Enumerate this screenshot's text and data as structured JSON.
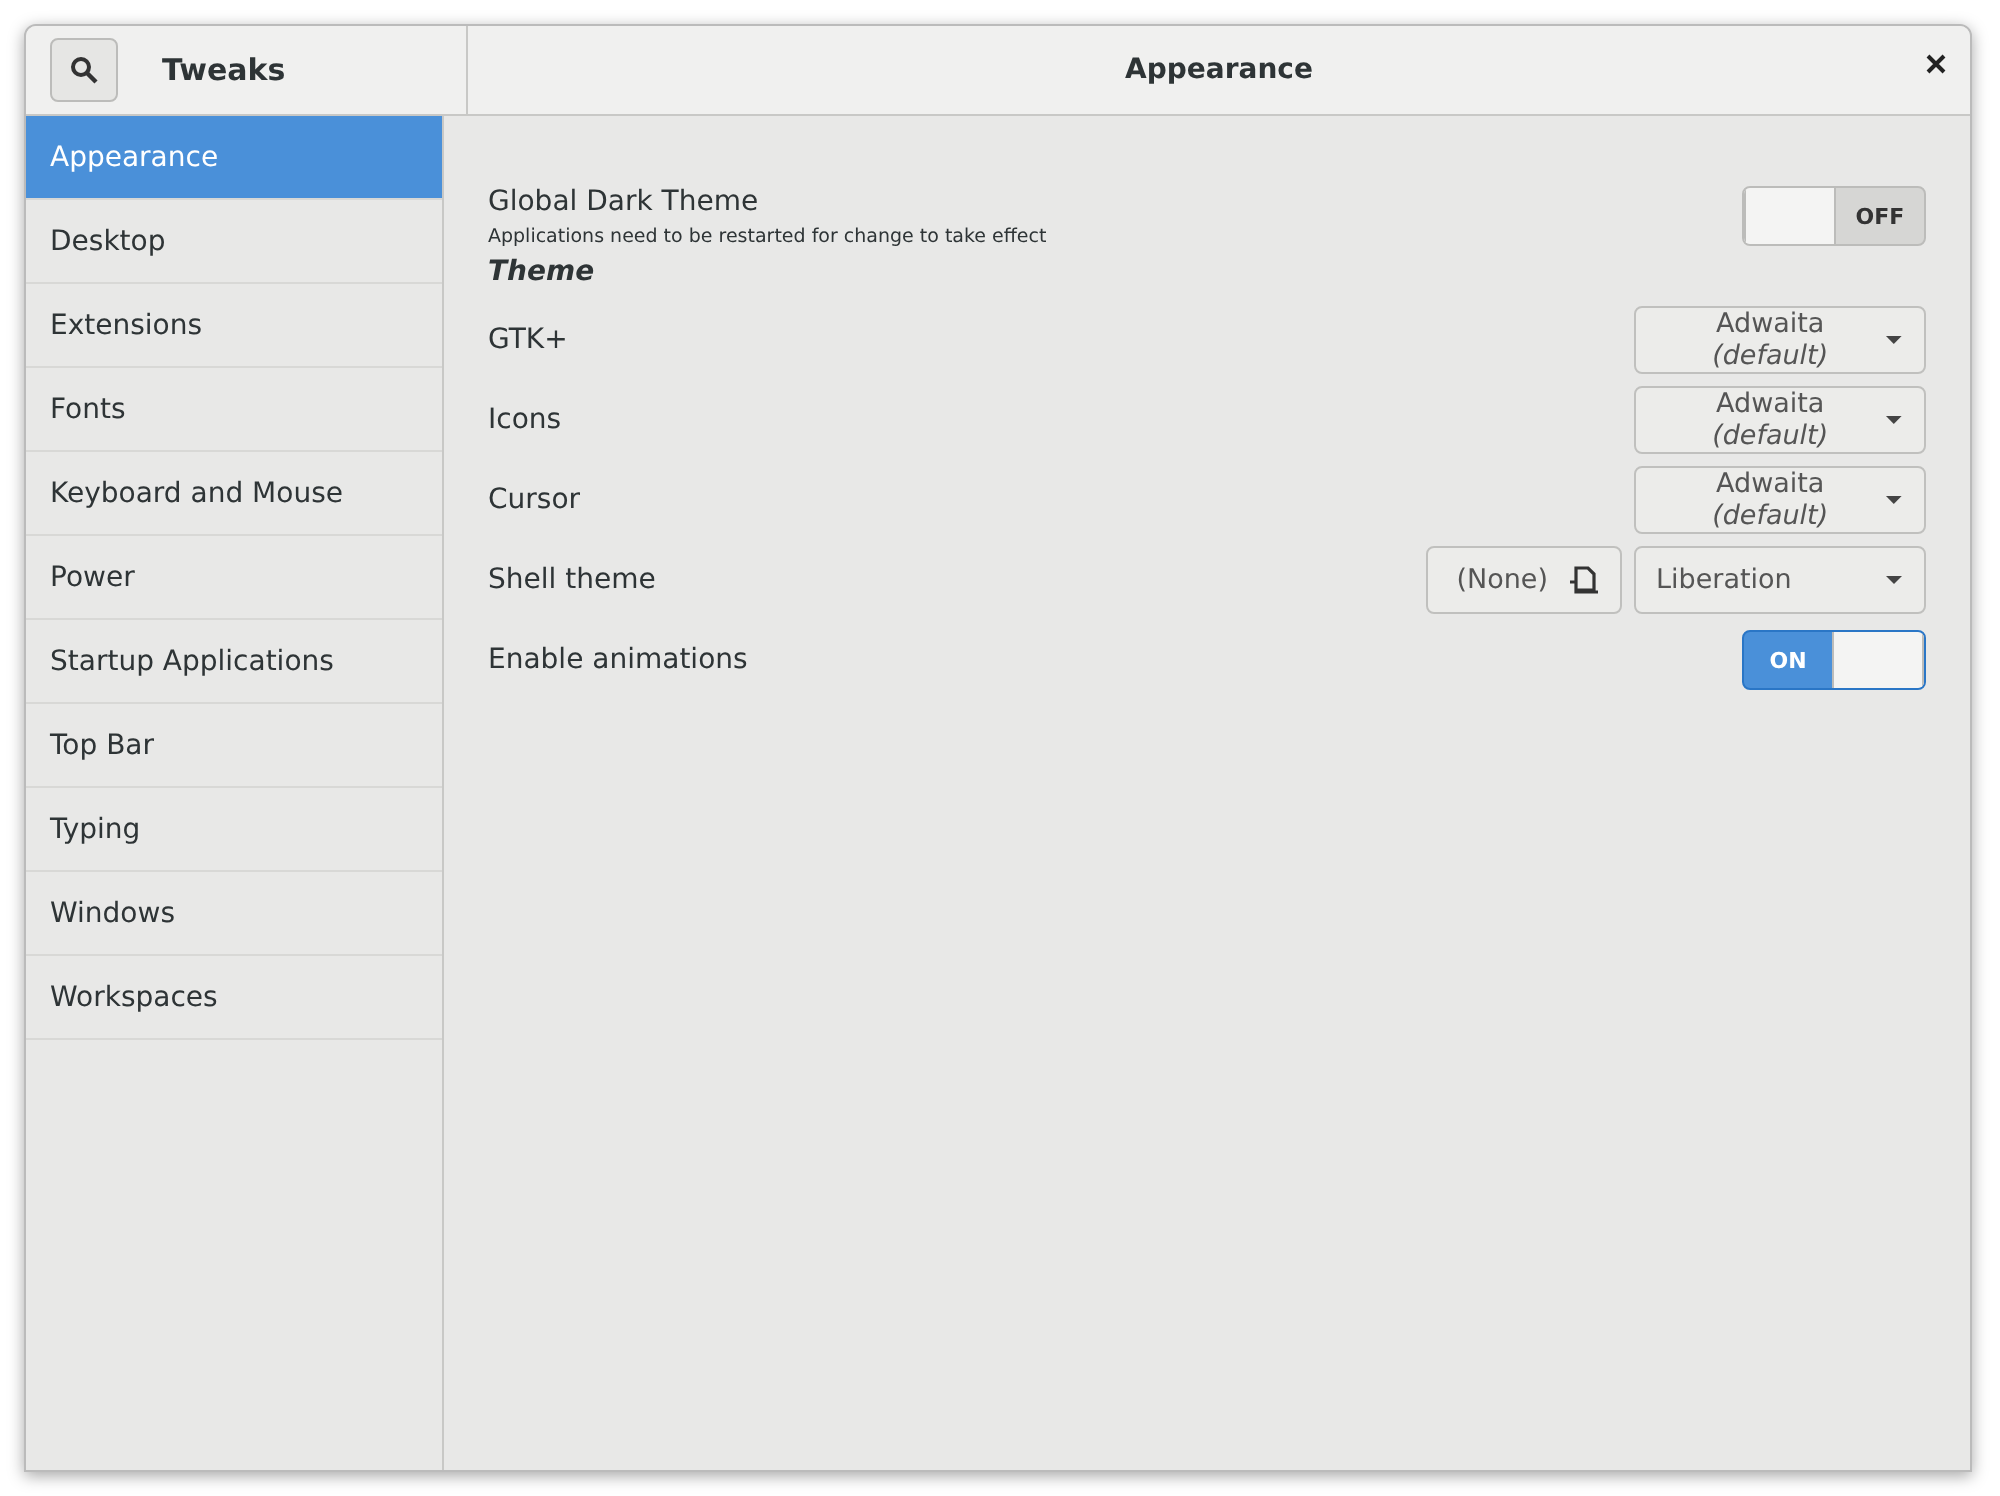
{
  "header": {
    "app_title": "Tweaks",
    "page_title": "Appearance"
  },
  "sidebar": {
    "items": [
      {
        "label": "Appearance",
        "selected": true
      },
      {
        "label": "Desktop",
        "selected": false
      },
      {
        "label": "Extensions",
        "selected": false
      },
      {
        "label": "Fonts",
        "selected": false
      },
      {
        "label": "Keyboard and Mouse",
        "selected": false
      },
      {
        "label": "Power",
        "selected": false
      },
      {
        "label": "Startup Applications",
        "selected": false
      },
      {
        "label": "Top Bar",
        "selected": false
      },
      {
        "label": "Typing",
        "selected": false
      },
      {
        "label": "Windows",
        "selected": false
      },
      {
        "label": "Workspaces",
        "selected": false
      }
    ]
  },
  "settings": [
    {
      "kind": "switch",
      "label": "Global Dark Theme",
      "description": "Applications need to be restarted for change to take effect",
      "on": false,
      "switch_text": "OFF"
    },
    {
      "kind": "heading",
      "label": "Theme"
    },
    {
      "kind": "dropdown",
      "label": "GTK+",
      "value": "Adwaita *(default)*"
    },
    {
      "kind": "dropdown",
      "label": "Icons",
      "value": "Adwaita *(default)*"
    },
    {
      "kind": "dropdown",
      "label": "Cursor",
      "value": "Adwaita *(default)*"
    },
    {
      "kind": "dropdown",
      "label": "Shell theme",
      "button": "(None)",
      "value": "Liberation"
    },
    {
      "kind": "switch",
      "label": "Enable animations",
      "on": true,
      "switch_text": "ON"
    }
  ]
}
